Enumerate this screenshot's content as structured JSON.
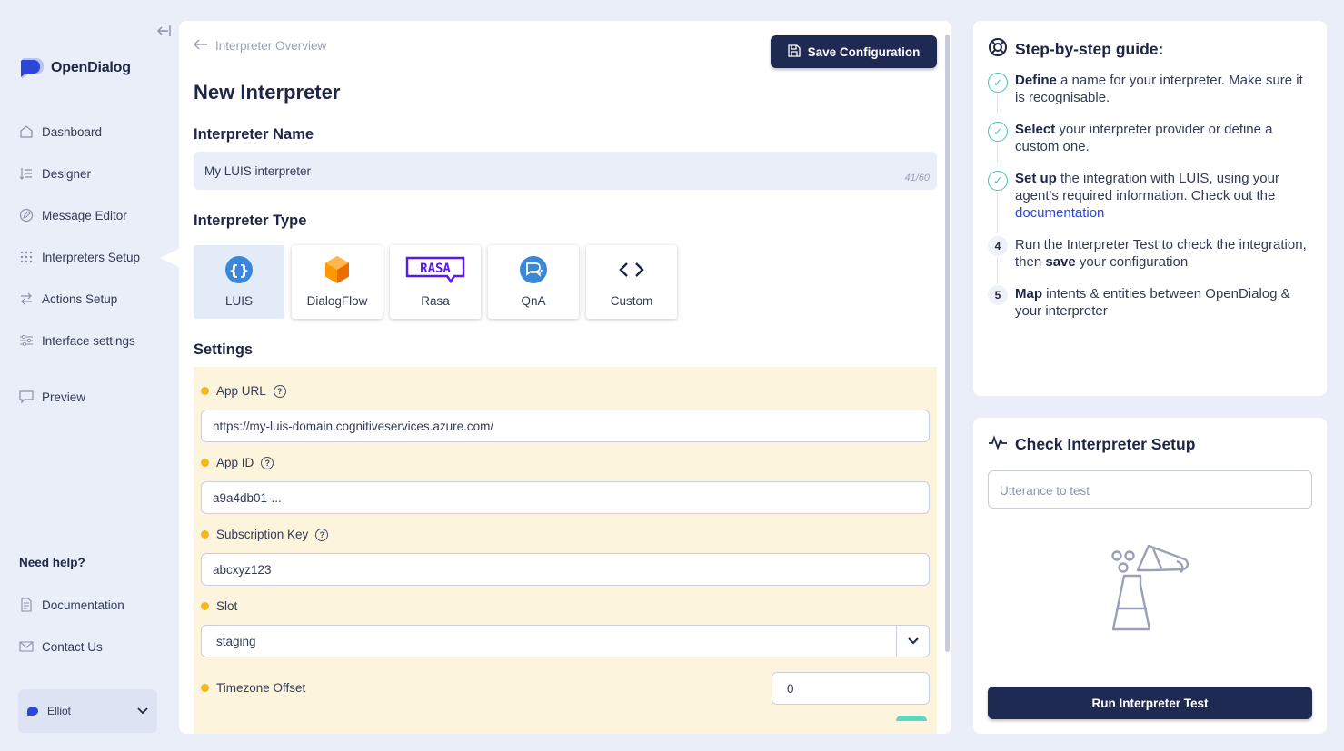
{
  "app": {
    "name": "OpenDialog"
  },
  "sidebar": {
    "items": [
      {
        "label": "Dashboard",
        "icon": "home-icon"
      },
      {
        "label": "Designer",
        "icon": "list-icon"
      },
      {
        "label": "Message Editor",
        "icon": "edit-icon"
      },
      {
        "label": "Interpreters Setup",
        "icon": "grid-icon",
        "active": true
      },
      {
        "label": "Actions Setup",
        "icon": "arrows-icon"
      },
      {
        "label": "Interface settings",
        "icon": "sliders-icon"
      },
      {
        "label": "Preview",
        "icon": "chat-icon"
      }
    ],
    "help_title": "Need help?",
    "help_items": [
      {
        "label": "Documentation",
        "icon": "document-icon"
      },
      {
        "label": "Contact Us",
        "icon": "mail-icon"
      }
    ],
    "user_name": "Elliot"
  },
  "main": {
    "back_label": "Interpreter Overview",
    "save_label": "Save Configuration",
    "title": "New Interpreter",
    "name_heading": "Interpreter Name",
    "name_value": "My LUIS interpreter",
    "name_counter": "41/60",
    "type_heading": "Interpreter Type",
    "types": [
      {
        "label": "LUIS",
        "selected": true
      },
      {
        "label": "DialogFlow"
      },
      {
        "label": "Rasa"
      },
      {
        "label": "QnA"
      },
      {
        "label": "Custom"
      }
    ],
    "settings_heading": "Settings",
    "fields": {
      "app_url": {
        "label": "App URL",
        "value": "https://my-luis-domain.cognitiveservices.azure.com/"
      },
      "app_id": {
        "label": "App ID",
        "value": "a9a4db01-..."
      },
      "sub_key": {
        "label": "Subscription Key",
        "value": "abcxyz123"
      },
      "slot": {
        "label": "Slot",
        "value": "staging"
      },
      "timezone": {
        "label": "Timezone Offset",
        "value": "0"
      }
    },
    "help_glyph": "?"
  },
  "guide": {
    "title": "Step-by-step guide:",
    "steps": [
      {
        "bold": "Define",
        "text": " a name for your interpreter. Make sure it is recognisable."
      },
      {
        "bold": "Select",
        "text": " your interpreter provider or define a custom one."
      },
      {
        "bold": "Set up",
        "text": " the integration with LUIS, using your agent's required information. Check out the ",
        "link": "documentation"
      },
      {
        "num": "4",
        "pre": "Run the Interpreter Test to check the integration, then ",
        "bold": "save",
        "text": " your configuration"
      },
      {
        "num": "5",
        "bold": "Map",
        "text": " intents & entities between OpenDialog & your interpreter"
      }
    ]
  },
  "check": {
    "title": "Check Interpreter Setup",
    "placeholder": "Utterance to test",
    "run_label": "Run Interpreter Test"
  },
  "colors": {
    "navy": "#1f2a52",
    "accent_blue": "#2d45d9",
    "required_dot": "#f4b81e",
    "done_green": "#3fc7a8",
    "settings_bg": "#fdf4dd",
    "page_bg": "#e9eef9"
  }
}
